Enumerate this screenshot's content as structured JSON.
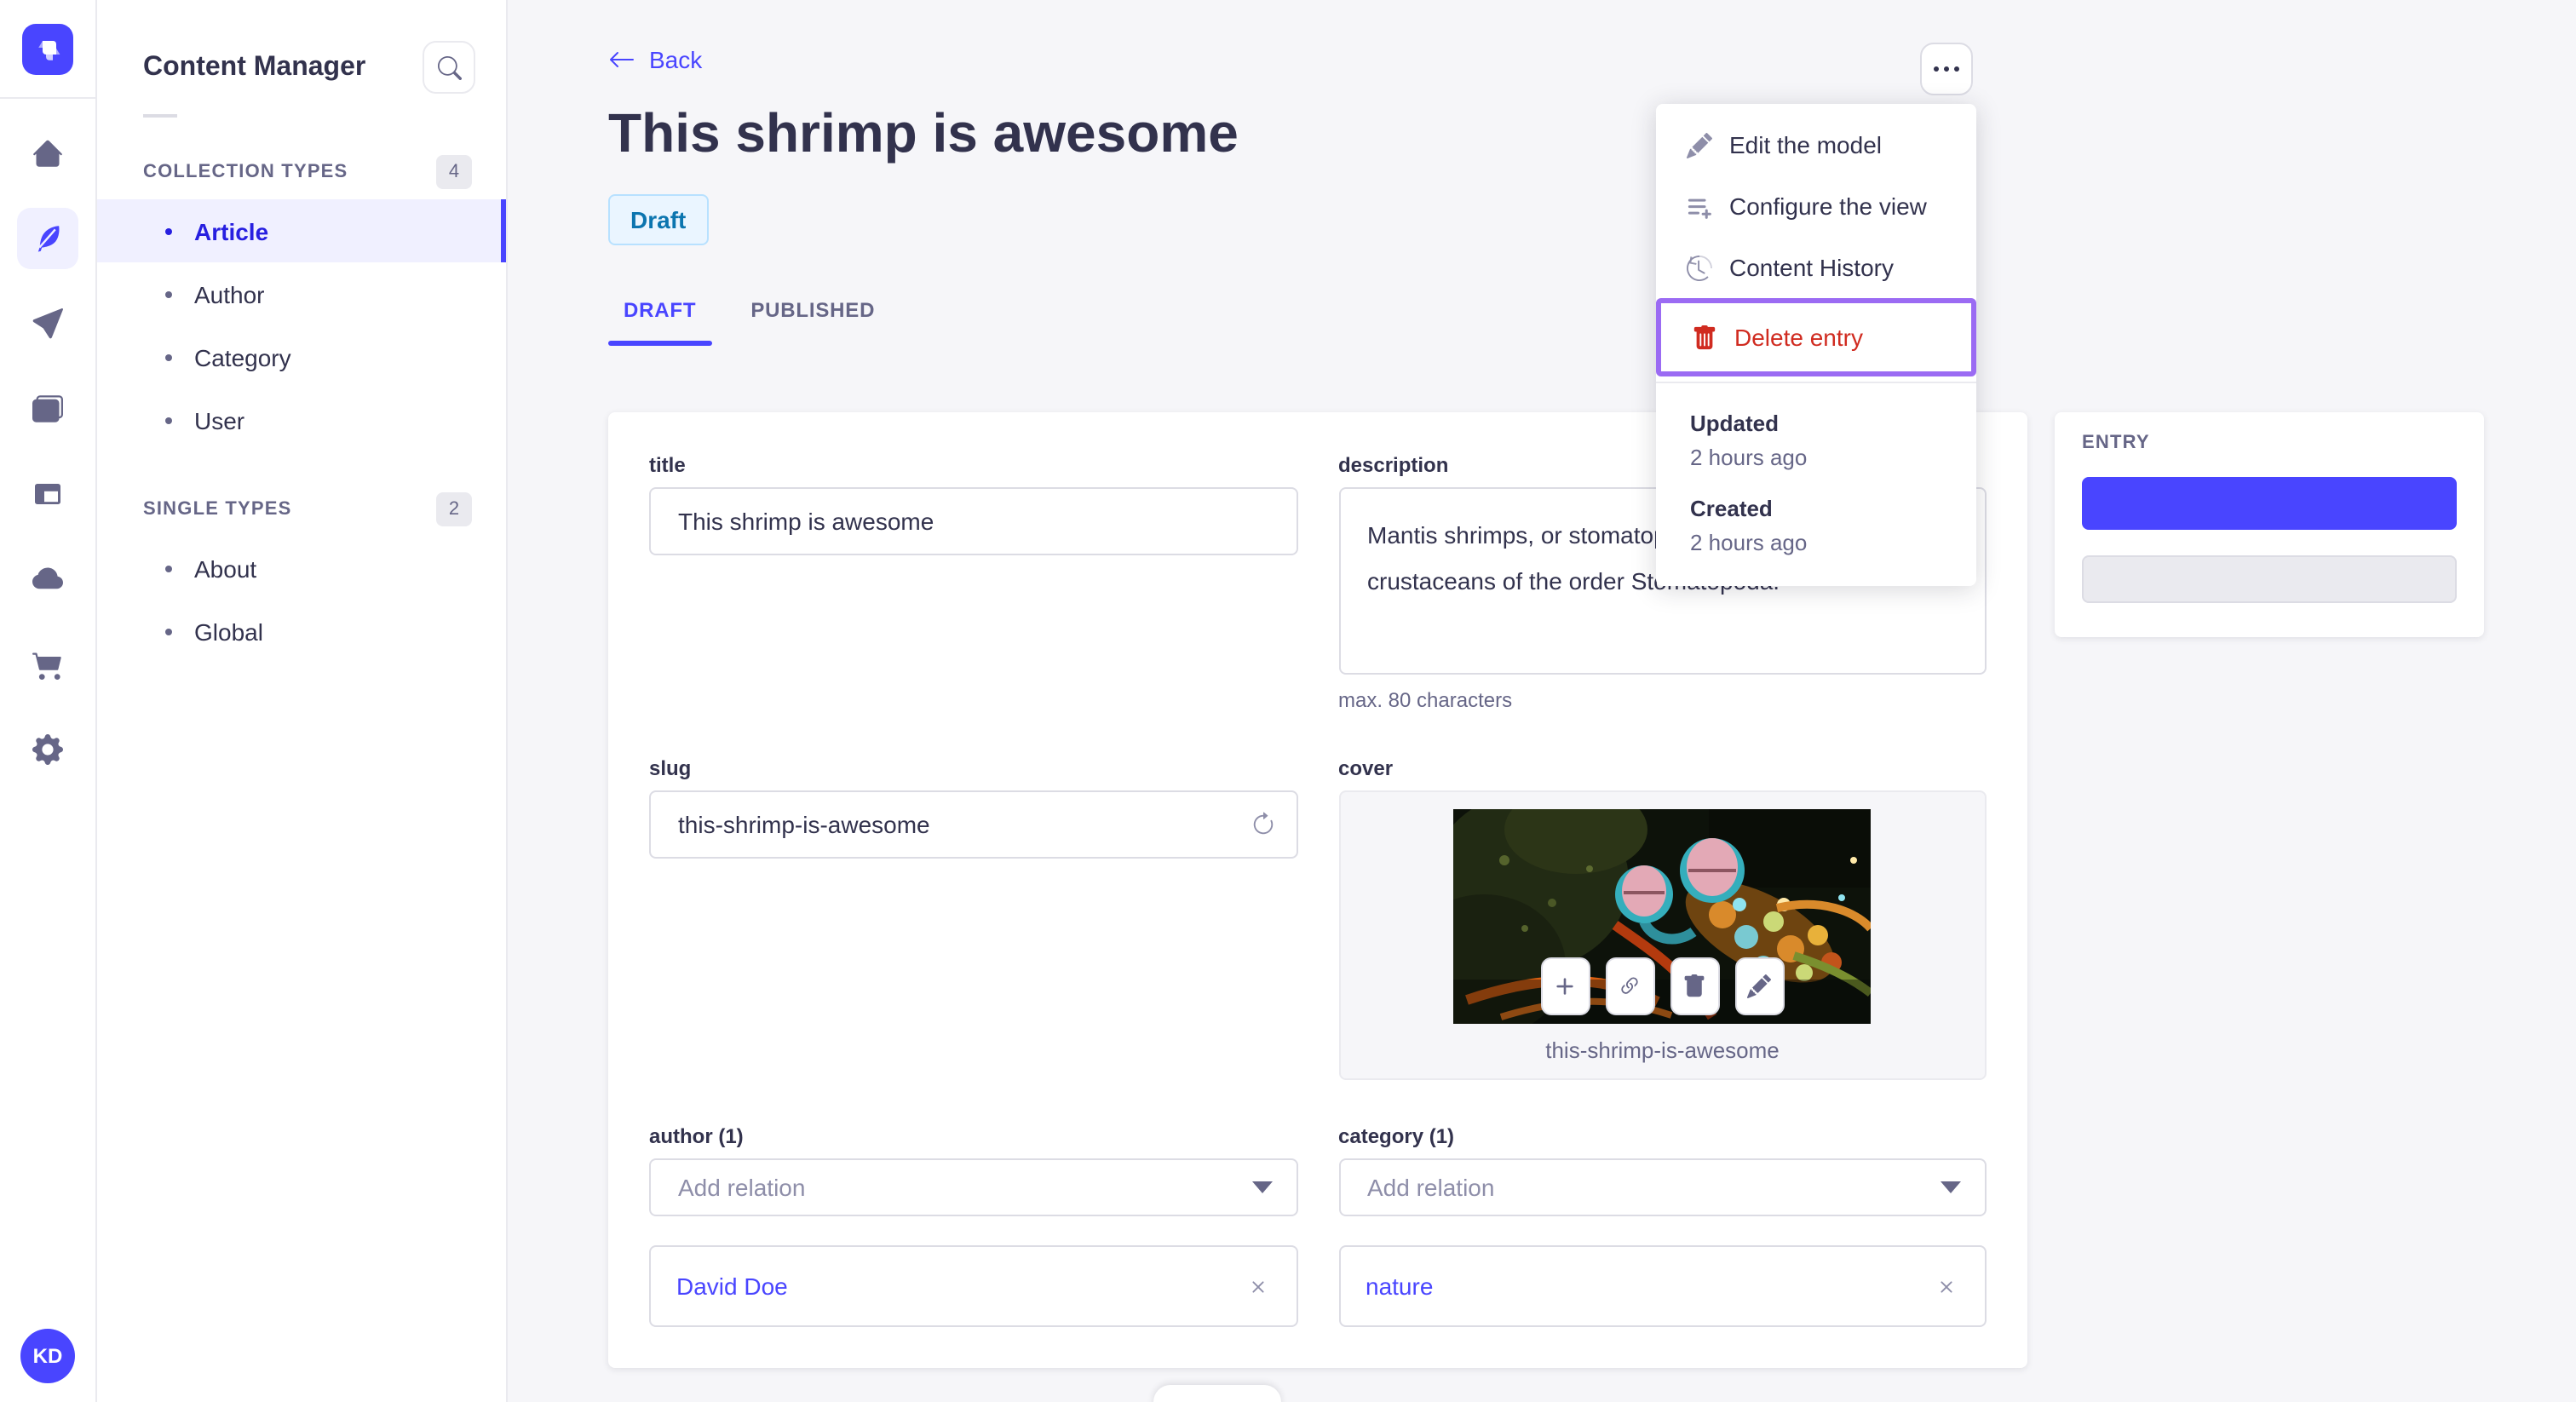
{
  "subnav": {
    "title": "Content Manager",
    "sections": [
      {
        "label": "COLLECTION TYPES",
        "count": "4",
        "items": [
          {
            "label": "Article"
          },
          {
            "label": "Author"
          },
          {
            "label": "Category"
          },
          {
            "label": "User"
          }
        ]
      },
      {
        "label": "SINGLE TYPES",
        "count": "2",
        "items": [
          {
            "label": "About"
          },
          {
            "label": "Global"
          }
        ]
      }
    ]
  },
  "rail": {
    "icons": [
      "home-icon",
      "content-manager-icon",
      "send-icon",
      "media-library-icon",
      "layout-icon",
      "cloud-icon",
      "marketplace-icon",
      "settings-icon"
    ],
    "avatar_initials": "KD"
  },
  "header": {
    "back_label": "Back",
    "title": "This shrimp is awesome",
    "status": "Draft",
    "tabs": {
      "draft": "DRAFT",
      "published": "PUBLISHED"
    }
  },
  "form": {
    "title": {
      "label": "title",
      "value": "This shrimp is awesome"
    },
    "description": {
      "label": "description",
      "value": "Mantis shrimps, or stomatopods, are marine crustaceans of the order Stomatopoda.",
      "helper": "max. 80 characters"
    },
    "slug": {
      "label": "slug",
      "value": "this-shrimp-is-awesome"
    },
    "cover": {
      "label": "cover",
      "filename": "this-shrimp-is-awesome"
    },
    "author": {
      "label": "author (1)",
      "placeholder": "Add relation",
      "relation": "David Doe"
    },
    "category": {
      "label": "category (1)",
      "placeholder": "Add relation",
      "relation": "nature"
    }
  },
  "entry_panel": {
    "label": "ENTRY"
  },
  "menu": {
    "edit": "Edit the model",
    "configure": "Configure the view",
    "history": "Content History",
    "delete": "Delete entry",
    "updated_label": "Updated",
    "updated_value": "2 hours ago",
    "created_label": "Created",
    "created_value": "2 hours ago"
  },
  "colors": {
    "primary": "#4945ff",
    "primary_dark": "#271fe0",
    "danger": "#d02b20",
    "highlight_border": "#9b6bf3",
    "draft_bg": "#eaf5ff",
    "draft_border": "#b8e1ff",
    "draft_text": "#0c75af"
  }
}
